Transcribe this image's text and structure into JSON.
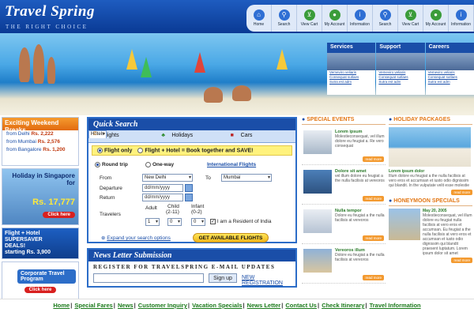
{
  "brand": {
    "logo": "Travel Spring",
    "tagline": "THE RIGHT CHOICE"
  },
  "nav": [
    {
      "label": "Home",
      "icon": "home-icon"
    },
    {
      "label": "Search",
      "icon": "search-icon"
    },
    {
      "label": "View Cart",
      "icon": "cart-icon"
    },
    {
      "label": "My Account",
      "icon": "account-icon"
    },
    {
      "label": "Information",
      "icon": "info-icon"
    },
    {
      "label": "Search",
      "icon": "search-icon"
    },
    {
      "label": "View Cart",
      "icon": "cart-icon"
    },
    {
      "label": "My Account",
      "icon": "account-icon"
    },
    {
      "label": "Information",
      "icon": "info-icon"
    }
  ],
  "hero_panel": [
    {
      "title": "Services",
      "links": [
        "Vemeviro veliaris",
        "Consequat sutlaes",
        "Sutra est adm"
      ]
    },
    {
      "title": "Support",
      "links": [
        "Vemeviro veliaris",
        "Consequat sutlaes",
        "Sutra est adm"
      ]
    },
    {
      "title": "Careers",
      "links": [
        "Vemeviro veliaris",
        "Consequat sutlaes",
        "Sutra est adm"
      ]
    }
  ],
  "left": {
    "weekend_title": "Exciting Weekend Breaks",
    "weekend": [
      {
        "from": "from Delhi",
        "price": "Rs. 2,222"
      },
      {
        "from": "from Mumbai",
        "price": "Rs. 2,576"
      },
      {
        "from": "from Bangalore",
        "price": "Rs. 1,200"
      }
    ],
    "singapore_title": "Holiday in Singapore for",
    "singapore_price": "Rs. 17,777",
    "click_here": "Click here",
    "saver_line1": "Flight + Hotel",
    "saver_line2": "SUPERSAVER",
    "saver_line3": "DEALS!",
    "saver_price": "starting Rs. 3,900",
    "corporate": "Corporate Travel Program",
    "click_here2": "Click here"
  },
  "quick_search": {
    "title": "Quick Search",
    "tabs": [
      "Flights",
      "Hotels",
      "Holidays",
      "Cars"
    ],
    "options_line": "Flight only  Flight + Hotel = Book together and SAVE!",
    "opt_flight_only": "Flight only",
    "opt_flight_hotel": "Flight + Hotel = Book together and SAVE!",
    "round_trip": "Round trip",
    "one_way": "One-way",
    "international": "International Flights",
    "from_label": "From",
    "from_value": "New Delhi",
    "to_label": "To",
    "to_value": "Mumbai",
    "departure_label": "Departure",
    "departure_value": "dd/mm/yyyy",
    "return_label": "Return",
    "return_value": "dd/mm/yyyy",
    "travelers_label": "Travelers",
    "adult_label": "Adult",
    "child_label": "Child",
    "child_range": "(2-11)",
    "infant_label": "Infant",
    "infant_range": "(0-2)",
    "adult_value": "1",
    "child_value": "0",
    "infant_value": "0",
    "resident": "I am a Resident of India",
    "expand": "Expand your search options",
    "get_flights": "GET AVAILABLE FLIGHTS"
  },
  "newsletter": {
    "title": "News Letter Submission",
    "register": "REGISTER FOR TRAVELSPRING E-MAIL UPDATES",
    "signup": "Sign up",
    "new_registration": "NEW REGISTRATION"
  },
  "special_events": {
    "title": "SPECIAL EVENTS",
    "items": [
      {
        "head": "Lorem ipsum",
        "text": "Molestieconsequat, vel illum dolore eu feugiat a. Re vero consequat"
      },
      {
        "head": "Dolore sit amet",
        "text": "vel illum dolore eu feugiat a the nulla facilisis at vereoros"
      },
      {
        "head": "Nulla tempor",
        "text": "Dolore eu feugiat a the nulla facilisis at vereoros"
      },
      {
        "head": "Vereoros illum",
        "text": "Dolore eu feugiat a the nulla facilisis at vereoros"
      }
    ],
    "read_more": "read more"
  },
  "holiday": {
    "title": "HOLIDAY PACKAGES",
    "head": "Lorem ipsum dolor",
    "text": "Illum dolore eu feugiat a the nulla facilisis at vero eros et accumsan et iusto odio dignissim qui blandit. In the vulputate velit esse molestie",
    "read_more": "read more"
  },
  "honeymoon": {
    "title": "HONEYMOON SPECIALS",
    "head": "May 20, 2005",
    "text": "Molestieconsequat, vel illum dolore eu feugiat nulla facilisis at vero eros et accumsan. Eu feugiat a the nulla facilisis at vero eros et accumsan et iusto odio dignissim qui blandit praesent luptatum. Lorem ipsum dolor sit amet",
    "read_more": "read more"
  },
  "footer": [
    "Home",
    "Special Fares",
    "News",
    "Customer Inquiry",
    "Vacation Specials",
    "News Letter",
    "Contact Us",
    "Check Itinerary",
    "Travel Information"
  ]
}
